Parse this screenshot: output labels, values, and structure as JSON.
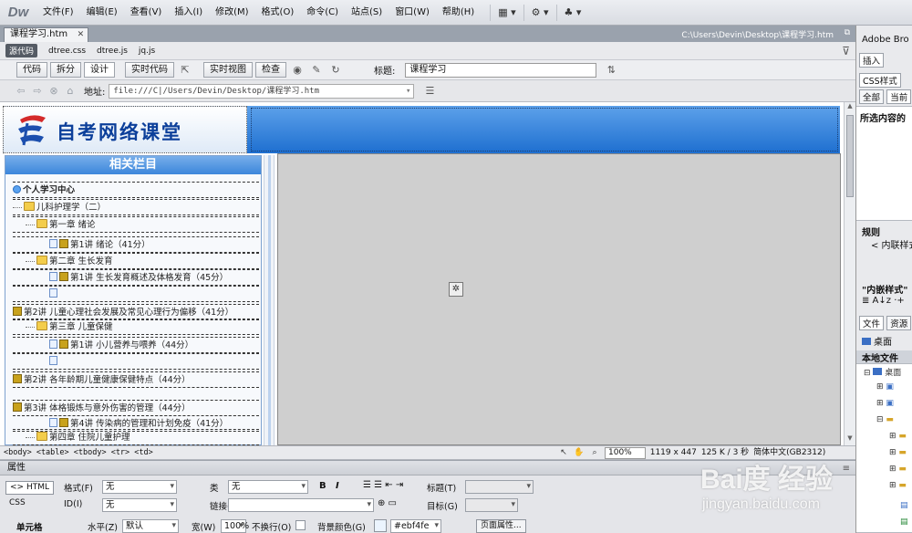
{
  "app": {
    "logo": "Dw"
  },
  "menu": [
    "文件(F)",
    "编辑(E)",
    "查看(V)",
    "插入(I)",
    "修改(M)",
    "格式(O)",
    "命令(C)",
    "站点(S)",
    "窗口(W)",
    "帮助(H)"
  ],
  "menu_tools": [
    "▦ ▾",
    "⚙ ▾",
    "♣ ▾"
  ],
  "doc": {
    "tab": "课程学习.htm",
    "path": "C:\\Users\\Devin\\Desktop\\课程学习.htm",
    "source_code": "源代码",
    "related_files": [
      "dtree.css",
      "dtree.js",
      "jq.js"
    ]
  },
  "view": {
    "buttons": [
      "代码",
      "拆分",
      "设计",
      "实时代码",
      "实时视图",
      "检查"
    ],
    "title_label": "标题:",
    "title_value": "课程学习"
  },
  "address": {
    "label": "地址:",
    "value": "file:///C|/Users/Devin/Desktop/课程学习.htm"
  },
  "page": {
    "site_name": "自考网络课堂",
    "side_header": "相关栏目",
    "tree": [
      "个人学习中心",
      "儿科护理学（二）",
      "第一章 绪论",
      "第1讲 绪论（41分）",
      "第二章 生长发育",
      "第1讲 生长发育概述及体格发育（45分）",
      "",
      "第2讲 儿童心理社会发展及常见心理行为偏移（41分）",
      "第三章 儿童保健",
      "第1讲 小儿营养与喂养（44分）",
      "",
      "第2讲 各年龄期儿童健康保健特点（44分）",
      "第3讲 体格锻炼与意外伤害的管理（44分）",
      "第4讲 传染病的管理和计划免疫（41分）",
      "第四章 住院儿童护理"
    ]
  },
  "status": {
    "tag_selector": "<body> <table> <tbody> <tr> <td>",
    "zoom": "100%",
    "size": "1119 x 447",
    "file_info": "125 K / 3 秒",
    "encoding": "简体中文(GB2312)"
  },
  "props": {
    "title": "属性",
    "html_btn": "<> HTML",
    "css_btn": "CSS",
    "format_label": "格式(F)",
    "format_value": "无",
    "class_label": "类",
    "class_value": "无",
    "id_label": "ID(I)",
    "id_value": "无",
    "link_label": "链接(L)",
    "heading_label": "标题(T)",
    "target_label": "目标(G)",
    "cell_label": "单元格",
    "horz_label": "水平(Z)",
    "horz_value": "默认",
    "width_label": "宽(W)",
    "width_value": "100%",
    "nowrap_label": "不换行(O)",
    "bg_label": "背景颜色(G)",
    "bg_value": "#ebf4fe",
    "page_props": "页面属性..."
  },
  "right_panel": {
    "title": "Adobe Bro",
    "insert_tab": "插入",
    "css_tab": "CSS样式",
    "all_tab": "全部",
    "current_tab": "当前",
    "selected_info": "所选内容的",
    "rules": "规则",
    "inline": "< 内联样式",
    "inline_style": "\"内嵌样式\"",
    "files_tab": "文件",
    "assets_tab": "资源",
    "desktop": "桌面",
    "local_files": "本地文件",
    "desktop_item": "桌面"
  },
  "watermark": {
    "brand": "Bai度 经验",
    "url": "jingyan.baidu.com"
  },
  "colors": {
    "banner": "#1e6fd0",
    "cell_bg": "#ebf4fe",
    "site_name": "#0c3f9a"
  }
}
